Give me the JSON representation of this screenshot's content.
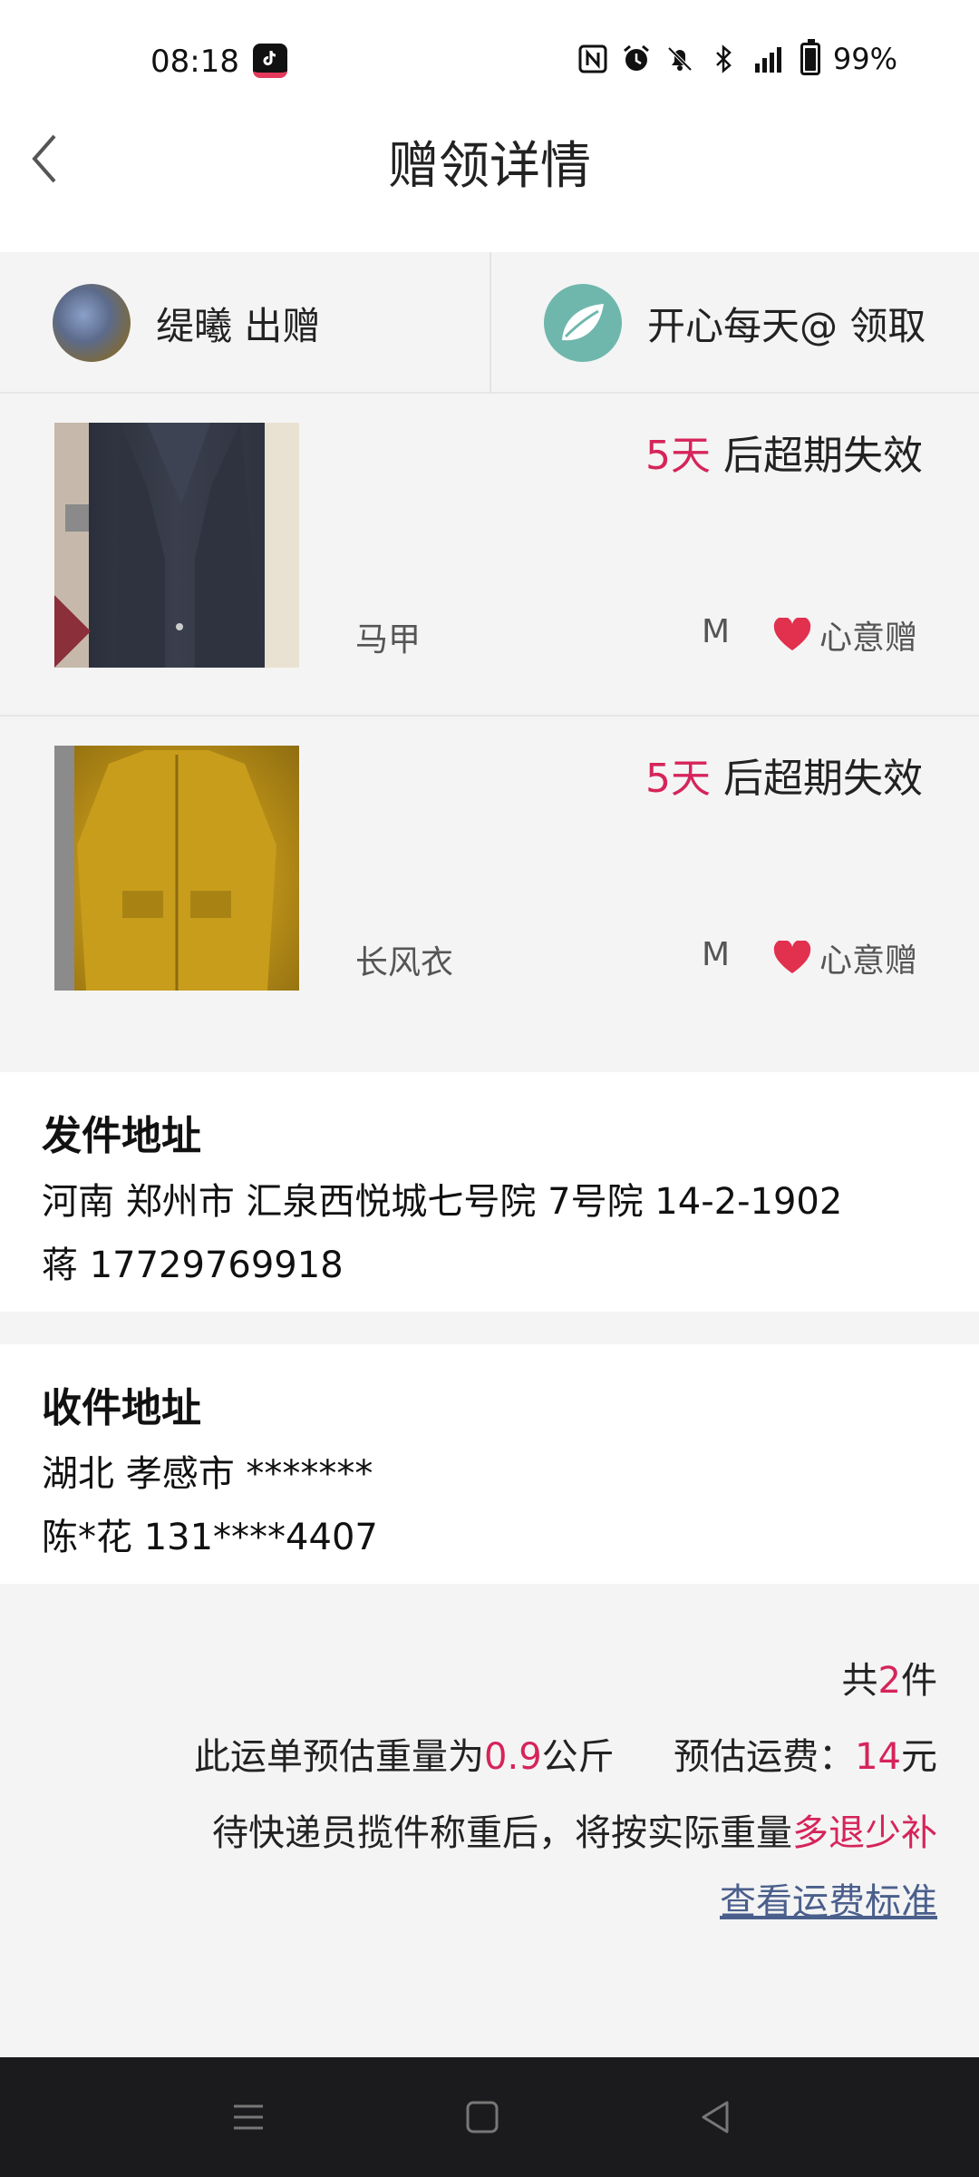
{
  "status_bar": {
    "time": "08:18",
    "battery": "99%",
    "icons": [
      "tiktok-icon",
      "nfc-icon",
      "alarm-icon",
      "mute-icon",
      "bluetooth-icon",
      "signal-4g-icon",
      "battery-icon"
    ]
  },
  "header": {
    "title": "赠领详情",
    "back_icon": "chevron-left-icon"
  },
  "parties": {
    "giver": "缇曦 出赠",
    "receiver": "开心每天@ 领取"
  },
  "items": [
    {
      "expire_days": "5天",
      "expire_suffix": " 后超期失效",
      "name": "马甲",
      "size": "M",
      "tag": "心意赠"
    },
    {
      "expire_days": "5天",
      "expire_suffix": " 后超期失效",
      "name": "长风衣",
      "size": "M",
      "tag": "心意赠"
    }
  ],
  "send_address": {
    "title": "发件地址",
    "address": "河南 郑州市 汇泉西悦城七号院 7号院 14-2-1902",
    "contact": "蒋 17729769918"
  },
  "recv_address": {
    "title": "收件地址",
    "address": "湖北 孝感市 *******",
    "contact": "陈*花 131****4407"
  },
  "summary": {
    "count_prefix": "共",
    "count": "2",
    "count_suffix": "件",
    "weight_prefix": "此运单预估重量为",
    "weight": "0.9",
    "weight_unit": "公斤",
    "fee_prefix": "预估运费：",
    "fee": "14",
    "fee_unit": "元",
    "note_prefix": "待快递员揽件称重后，将按实际重量",
    "note_highlight": "多退少补",
    "fee_link": "查看运费标准"
  },
  "colors": {
    "accent": "#d6245a",
    "link": "#4a5f8c",
    "nav_bar": "#1b1b1d"
  }
}
